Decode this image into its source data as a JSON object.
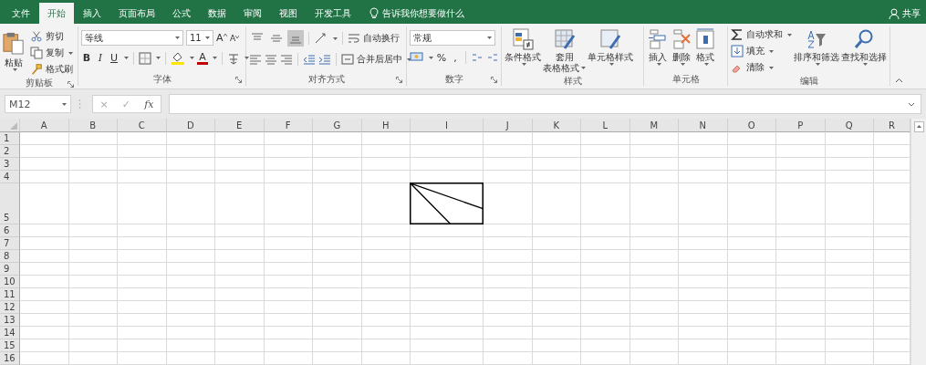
{
  "tabs": [
    {
      "label": "文件",
      "selected": false
    },
    {
      "label": "开始",
      "selected": true
    },
    {
      "label": "插入",
      "selected": false
    },
    {
      "label": "页面布局",
      "selected": false
    },
    {
      "label": "公式",
      "selected": false
    },
    {
      "label": "数据",
      "selected": false
    },
    {
      "label": "审阅",
      "selected": false
    },
    {
      "label": "视图",
      "selected": false
    },
    {
      "label": "开发工具",
      "selected": false
    }
  ],
  "tell_me": {
    "text": "告诉我你想要做什么"
  },
  "share": {
    "label": "共享"
  },
  "ribbon": {
    "clipboard": {
      "label": "剪贴板",
      "paste": "粘贴",
      "cut": "剪切",
      "copy": "复制",
      "format_painter": "格式刷"
    },
    "font": {
      "label": "字体",
      "font_name": "等线",
      "font_size": "11",
      "grow": "A",
      "shrink": "A",
      "bold": "B",
      "italic": "I",
      "underline": "U",
      "font_color": "A"
    },
    "alignment": {
      "label": "对齐方式",
      "vertical": [
        {
          "kind": "top",
          "selected": false
        },
        {
          "kind": "middle",
          "selected": false
        },
        {
          "kind": "bottom",
          "selected": true
        }
      ],
      "wrap_text": "自动换行",
      "merge_center": "合并后居中"
    },
    "number": {
      "label": "数字",
      "format": "常规",
      "percent": "%",
      "comma": ","
    },
    "styles": {
      "label": "样式",
      "buttons": [
        {
          "kind": "conditional",
          "lines": [
            "条件格式"
          ]
        },
        {
          "kind": "table",
          "lines": [
            "套用",
            "表格格式"
          ]
        },
        {
          "kind": "cell",
          "lines": [
            "单元格样式"
          ]
        }
      ]
    },
    "cells": {
      "label": "单元格",
      "buttons": [
        {
          "kind": "insert",
          "label": "插入"
        },
        {
          "kind": "delete",
          "label": "删除"
        },
        {
          "kind": "format",
          "label": "格式"
        }
      ]
    },
    "editing": {
      "label": "编辑",
      "items": [
        {
          "kind": "sum",
          "label": "自动求和"
        },
        {
          "kind": "fill",
          "label": "填充"
        },
        {
          "kind": "clear",
          "label": "清除"
        }
      ],
      "buttons": [
        {
          "kind": "sort",
          "label": "排序和筛选"
        },
        {
          "kind": "find",
          "label": "查找和选择"
        }
      ]
    }
  },
  "formula_bar": {
    "name_box": "M12",
    "cancel": "×",
    "enter": "✓",
    "function": "fx"
  },
  "sheet": {
    "columns": [
      "A",
      "B",
      "C",
      "D",
      "E",
      "F",
      "G",
      "H",
      "I",
      "J",
      "K",
      "L",
      "M",
      "N",
      "O",
      "P",
      "Q",
      "R"
    ],
    "rows": [
      "1",
      "2",
      "3",
      "4",
      "5",
      "6",
      "7",
      "8",
      "9",
      "10",
      "11",
      "12",
      "13",
      "14",
      "15",
      "16"
    ]
  }
}
